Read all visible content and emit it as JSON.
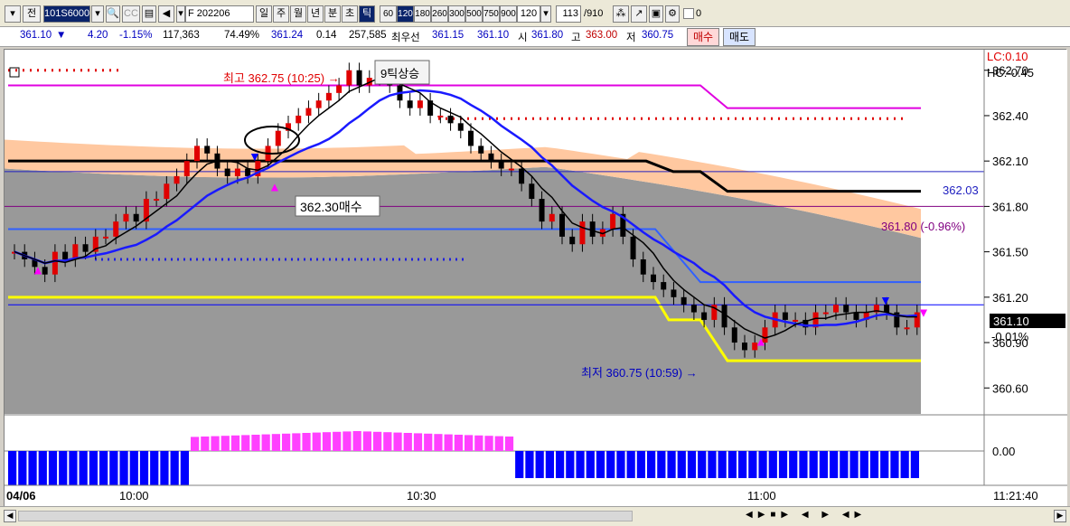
{
  "toolbar": {
    "tab_label": "전",
    "symbol": "101S6000",
    "product": "F 202206",
    "periods": [
      "일",
      "주",
      "월",
      "년",
      "분",
      "초",
      "틱"
    ],
    "ticks": [
      "60",
      "120",
      "180",
      "260",
      "300",
      "500",
      "750",
      "900"
    ],
    "tick_value": "120",
    "count": "113",
    "total": "910",
    "check_label": "0"
  },
  "quote": {
    "price": "361.10",
    "change_arrow": "▼",
    "change": "4.20",
    "change_pct": "-1.15%",
    "volume": "117,363",
    "vol_ratio": "74.49%",
    "bid": "361.24",
    "bid_diff": "0.14",
    "oi": "257,585",
    "best_label": "최우선",
    "best_bid": "361.15",
    "best_ask": "361.10",
    "open_label": "시",
    "open": "361.80",
    "high_label": "고",
    "high": "363.00",
    "low_label": "저",
    "low": "360.75",
    "buy_label": "매수",
    "sell_label": "매도"
  },
  "chart": {
    "annotations": {
      "high": "최고 362.75 (10:25) →",
      "tick_up": "9틱상승",
      "buy_signal": "362.30매수",
      "low": "최저 360.75 (10:59) →",
      "lc": "LC:0.10",
      "hc": "HC:-0.45",
      "level_blue": "362.03",
      "level_purple": "361.80 (-0.96%)",
      "last_price": "361.10",
      "last_pct": "-0.01%"
    },
    "price_ticks": [
      "362.70",
      "362.40",
      "362.10",
      "361.80",
      "361.50",
      "361.20",
      "360.90",
      "360.60"
    ],
    "osc_tick": "0.00",
    "time_labels": [
      "04/06",
      "10:00",
      "10:30",
      "11:00",
      "11:21:40"
    ]
  },
  "colors": {
    "bg_gray": "#999999",
    "band_orange": "#ffc8a0",
    "ma_black": "#000000",
    "ma_blue": "#1a1aff",
    "magenta": "#e000e0",
    "up_candle": "#e00000",
    "down_candle": "#000000",
    "osc_pos": "#ff40ff",
    "osc_neg": "#0000ff"
  },
  "chart_data": {
    "type": "candlestick",
    "ylim": [
      360.5,
      362.8
    ],
    "title": "",
    "high": {
      "value": 362.75,
      "time": "10:25"
    },
    "low": {
      "value": 360.75,
      "time": "10:59"
    },
    "closes": [
      361.5,
      361.45,
      361.4,
      361.35,
      361.5,
      361.45,
      361.55,
      361.5,
      361.6,
      361.6,
      361.7,
      361.75,
      361.7,
      361.85,
      361.85,
      361.95,
      362.0,
      362.1,
      362.2,
      362.15,
      362.05,
      362.0,
      362.05,
      362.0,
      362.1,
      362.2,
      362.3,
      362.35,
      362.4,
      362.45,
      362.5,
      362.55,
      362.6,
      362.7,
      362.6,
      362.65,
      362.7,
      362.6,
      362.5,
      362.45,
      362.5,
      362.4,
      362.4,
      362.35,
      362.3,
      362.2,
      362.15,
      362.1,
      362.05,
      362.05,
      361.95,
      361.85,
      361.7,
      361.75,
      361.6,
      361.55,
      361.7,
      361.6,
      361.65,
      361.75,
      361.6,
      361.45,
      361.35,
      361.3,
      361.25,
      361.2,
      361.15,
      361.1,
      361.05,
      361.15,
      361.0,
      360.9,
      360.85,
      360.9,
      361.0,
      361.1,
      361.05,
      361.05,
      361.0,
      361.1,
      361.1,
      361.15,
      361.1,
      361.05,
      361.1,
      361.15,
      361.1,
      361.0,
      361.0,
      361.1
    ]
  }
}
